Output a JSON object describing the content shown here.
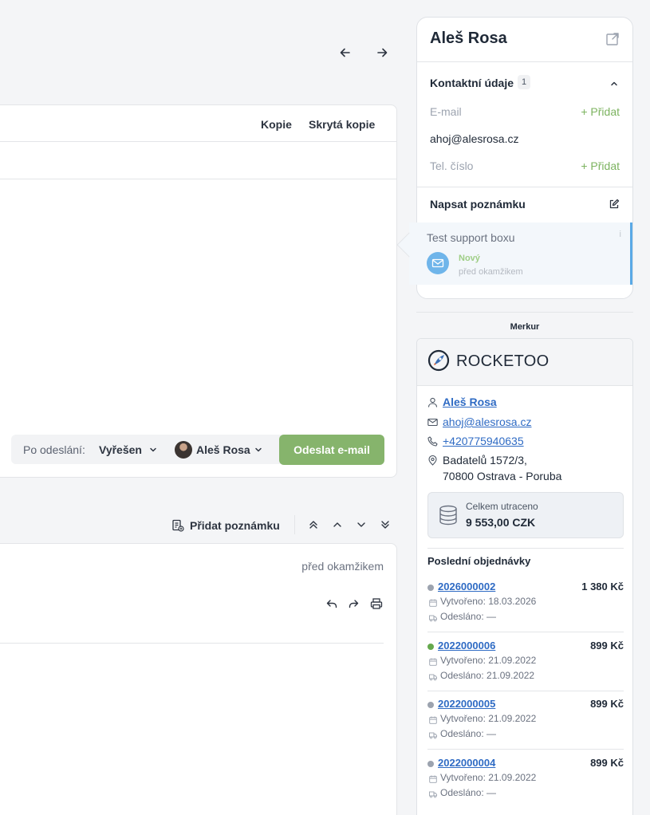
{
  "composer": {
    "cc_label": "Kopie",
    "bcc_label": "Skrytá kopie",
    "after_send_label": "Po odeslání:",
    "status_value": "Vyřešen",
    "assignee_name": "Aleš Rosa",
    "send_label": "Odeslat e-mail"
  },
  "toolbar": {
    "add_note_label": "Přidat poznámku"
  },
  "message": {
    "time": "před okamžikem"
  },
  "contact": {
    "name": "Aleš Rosa",
    "section_title": "Kontaktní údaje",
    "section_count": "1",
    "email_label": "E-mail",
    "email_add": "+ Přidat",
    "email_value": "ahoj@alesrosa.cz",
    "phone_label": "Tel. číslo",
    "phone_add": "+ Přidat",
    "note_title": "Napsat poznámku"
  },
  "ticket": {
    "title": "Test support boxu",
    "info": "i",
    "status": "Nový",
    "time": "před okamžikem",
    "accent_color": "#5aa9e6"
  },
  "merkur": {
    "label": "Merkur",
    "brand": "ROCKETOO",
    "customer_name": "Aleš Rosa",
    "customer_email": "ahoj@alesrosa.cz",
    "customer_phone": "+420775940635",
    "address_line1": "Badatelů 1572/3,",
    "address_line2": "70800 Ostrava - Poruba",
    "total_label": "Celkem utraceno",
    "total_value": "9 553,00 CZK",
    "orders_title": "Poslední objednávky",
    "orders": [
      {
        "number": "2026000002",
        "price": "1 380 Kč",
        "created": "Vytvořeno: 18.03.2026",
        "shipped": "Odesláno: —",
        "status_color": "#9ca3af"
      },
      {
        "number": "2022000006",
        "price": "899 Kč",
        "created": "Vytvořeno: 21.09.2022",
        "shipped": "Odesláno: 21.09.2022",
        "status_color": "#65a94d"
      },
      {
        "number": "2022000005",
        "price": "899 Kč",
        "created": "Vytvořeno: 21.09.2022",
        "shipped": "Odesláno: —",
        "status_color": "#9ca3af"
      },
      {
        "number": "2022000004",
        "price": "899 Kč",
        "created": "Vytvořeno: 21.09.2022",
        "shipped": "Odesláno: —",
        "status_color": "#9ca3af"
      }
    ]
  }
}
